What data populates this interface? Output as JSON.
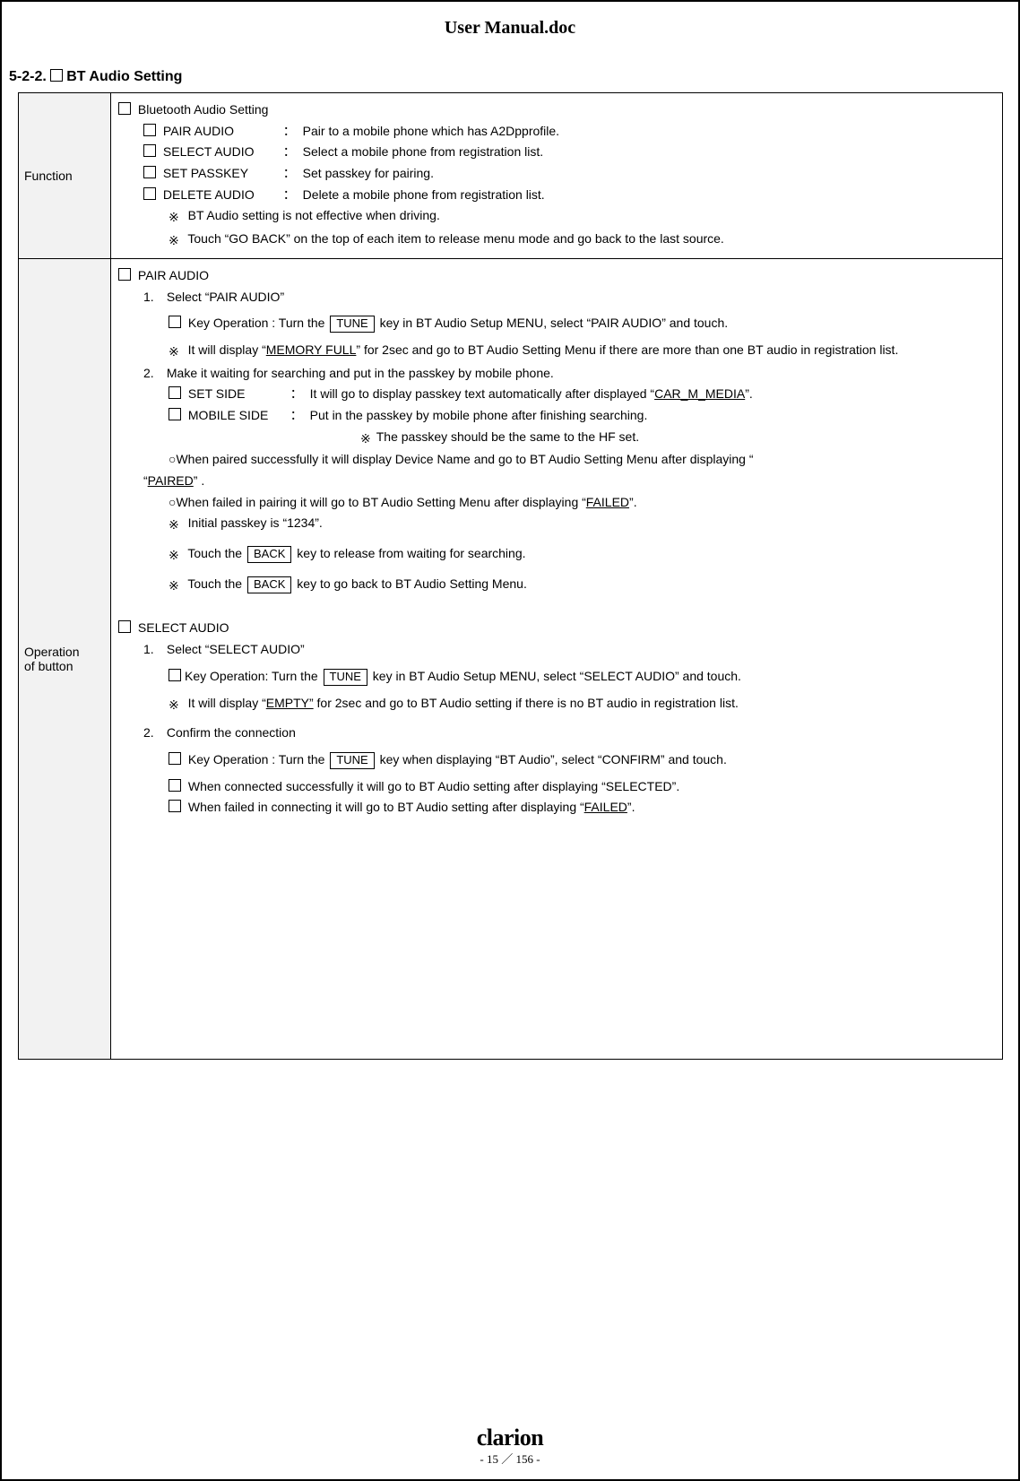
{
  "doc_title": "User Manual.doc",
  "section_number": "5-2-2. ",
  "section_title": "BT Audio Setting",
  "function": {
    "label": "Function",
    "heading": "Bluetooth Audio Setting",
    "items": [
      {
        "name": "PAIR AUDIO",
        "desc": "Pair to a mobile phone which has A2Dpprofile."
      },
      {
        "name": "SELECT AUDIO",
        "desc": "Select a mobile phone from registration list."
      },
      {
        "name": "SET PASSKEY",
        "desc": "Set passkey for pairing."
      },
      {
        "name": "DELETE AUDIO",
        "desc": "Delete a mobile phone from registration list."
      }
    ],
    "note1": "BT Audio setting is not effective when driving.",
    "note2": "Touch “GO BACK” on the top of each item to release menu mode and go back to the last source."
  },
  "operation": {
    "label1": "Operation",
    "label2": "of button",
    "pair_audio": {
      "heading": "PAIR AUDIO",
      "step1_label": "Select “PAIR AUDIO”",
      "step1_keyop_pre": "Key Operation  :  Turn the ",
      "step1_keyop_key": "TUNE",
      "step1_keyop_post": " key in BT Audio Setup MENU, select “PAIR AUDIO” and touch.",
      "step1_note_pre": "It will display “",
      "step1_note_mid": "MEMORY FULL",
      "step1_note_post": "” for 2sec and go to BT Audio Setting Menu if there are more than one BT audio in registration list.",
      "step2_label": "Make it waiting for searching and put in the passkey by mobile phone.",
      "set_side_label": "SET SIDE",
      "set_side_desc_pre": "It will go to display passkey text automatically after displayed “",
      "set_side_desc_mid": "CAR_M_MEDIA",
      "set_side_desc_post": "”.",
      "mobile_side_label": "MOBILE SIDE",
      "mobile_side_desc": "Put in the passkey by mobile phone after finishing searching.",
      "mobile_side_note": "The passkey should be the same to the HF set.",
      "success_pre": "○When paired successfully it will display Device Name and go to BT Audio Setting Menu after displaying “",
      "success_mid": "PAIRED",
      "success_post": "” .",
      "fail_pre": "○When failed in pairing it will go to BT Audio Setting Menu after displaying “",
      "fail_mid": "FAILED",
      "fail_post": "”.",
      "initial_passkey": "Initial passkey is “1234”.",
      "back1_pre": "Touch the ",
      "back1_key": "BACK",
      "back1_post": " key to release from waiting for searching.",
      "back2_pre": "Touch the ",
      "back2_key": "BACK",
      "back2_post": " key to go back to BT Audio Setting Menu."
    },
    "select_audio": {
      "heading": "SELECT AUDIO",
      "step1_label": "Select “SELECT AUDIO”",
      "step1_keyop_pre": "Key Operation:  Turn the ",
      "step1_keyop_key": "TUNE",
      "step1_keyop_post": " key in BT Audio Setup MENU, select “SELECT AUDIO” and touch.",
      "step1_note_pre": "It will display “",
      "step1_note_mid": "EMPTY”",
      "step1_note_post": " for 2sec and go to BT Audio setting if there is no BT audio in registration list.",
      "step2_label": "Confirm the connection",
      "step2_keyop_pre": "Key Operation  :  Turn the ",
      "step2_keyop_key": "TUNE",
      "step2_keyop_post": " key when displaying “BT Audio”, select “CONFIRM” and touch.",
      "success": "When connected successfully it will go to BT Audio setting after displaying “SELECTED”.",
      "fail_pre": "When failed in connecting it will go to BT Audio setting after displaying “",
      "fail_mid": "FAILED",
      "fail_post": "”."
    }
  },
  "footer": {
    "brand": "clarion",
    "page": "- 15 ／ 156 -"
  },
  "glyphs": {
    "ref": "※",
    "colon": "：",
    "num1": "1.",
    "num2": "2."
  }
}
